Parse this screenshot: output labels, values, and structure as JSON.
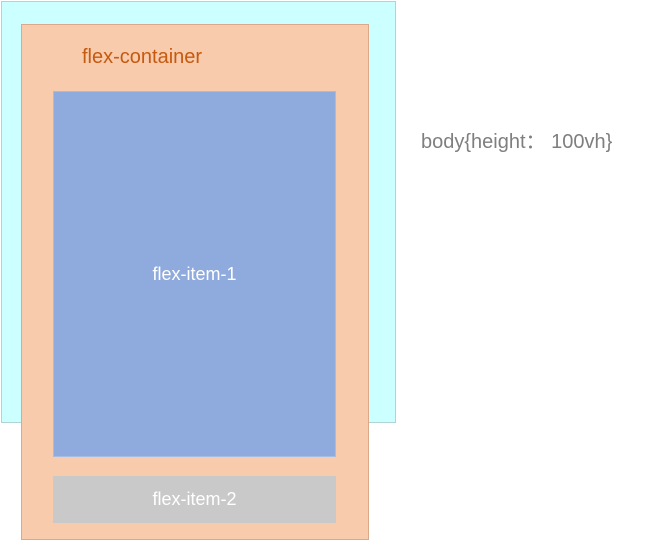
{
  "labels": {
    "container": "flex-container",
    "item_1": "flex-item-1",
    "item_2": "flex-item-2",
    "body_note": "body{height： 100vh}"
  },
  "colors": {
    "body_fill": "#ccffff",
    "container_fill": "#f8cbad",
    "container_label": "#c55a11",
    "item_1_fill": "#8faadc",
    "item_2_fill": "#c9c9c9",
    "note_text": "#7f7f7f"
  }
}
